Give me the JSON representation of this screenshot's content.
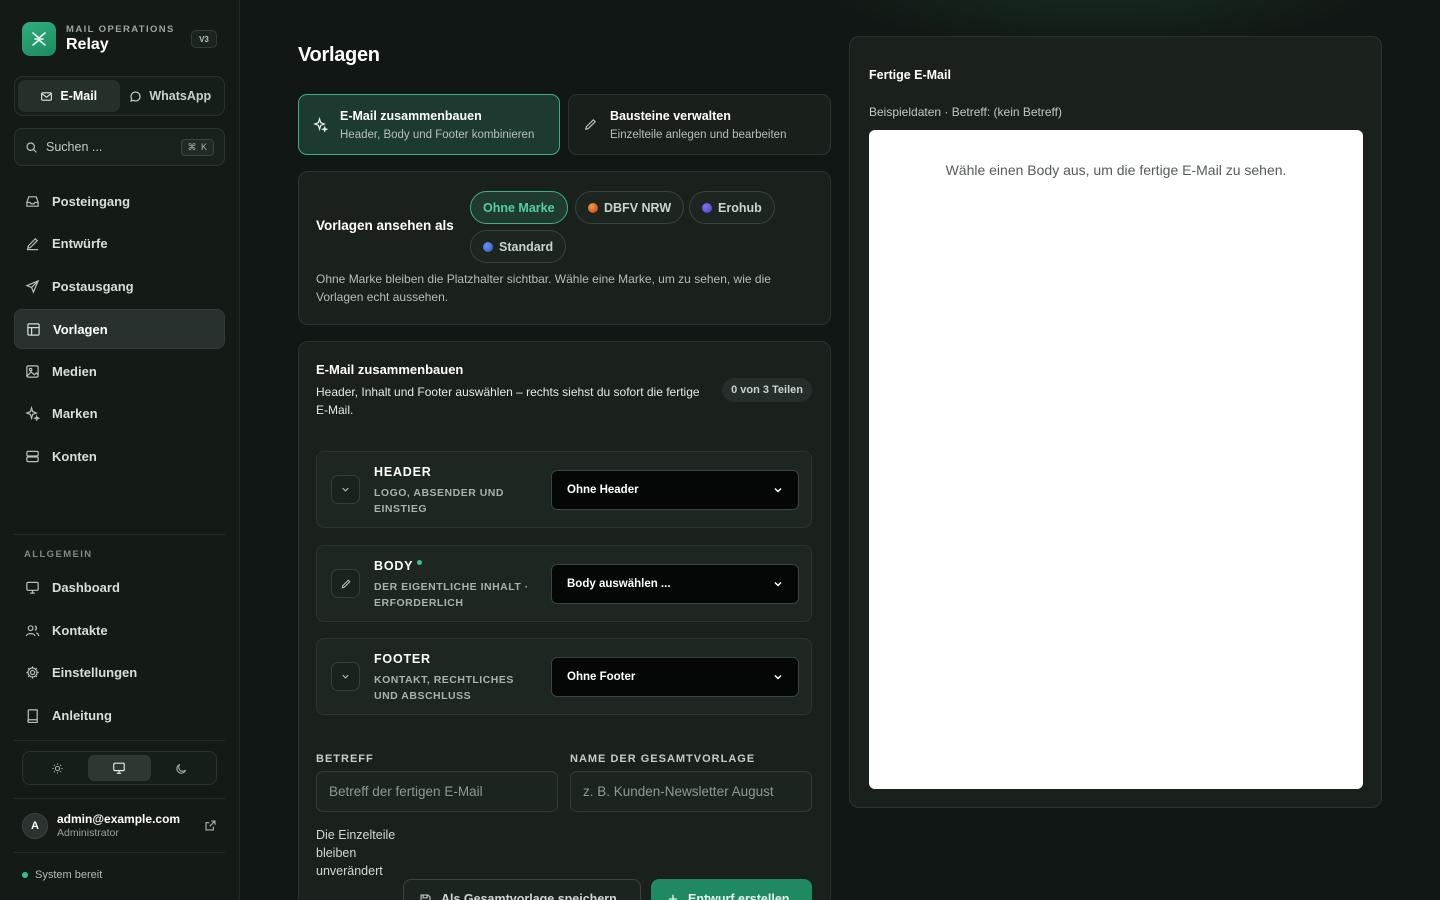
{
  "app": {
    "kicker": "MAIL OPERATIONS",
    "name": "Relay",
    "version": "V3"
  },
  "channels": [
    {
      "label": "E-Mail",
      "active": true
    },
    {
      "label": "WhatsApp",
      "active": false
    }
  ],
  "search": {
    "placeholder": "Suchen ...",
    "shortcut": "⌘ K"
  },
  "nav": [
    {
      "label": "Posteingang",
      "icon": "inbox-icon"
    },
    {
      "label": "Entwürfe",
      "icon": "pen-icon"
    },
    {
      "label": "Postausgang",
      "icon": "send-icon"
    },
    {
      "label": "Vorlagen",
      "icon": "layout-icon",
      "active": true
    },
    {
      "label": "Medien",
      "icon": "image-icon"
    },
    {
      "label": "Marken",
      "icon": "sparkles-icon"
    },
    {
      "label": "Konten",
      "icon": "server-icon"
    }
  ],
  "general": {
    "label": "ALLGEMEIN",
    "items": [
      {
        "label": "Dashboard",
        "icon": "monitor-icon"
      },
      {
        "label": "Kontakte",
        "icon": "users-icon"
      },
      {
        "label": "Einstellungen",
        "icon": "gear-icon"
      },
      {
        "label": "Anleitung",
        "icon": "book-icon"
      }
    ]
  },
  "theme": {
    "options": [
      "light",
      "system",
      "dark"
    ],
    "active": "system"
  },
  "user": {
    "initial": "A",
    "email": "admin@example.com",
    "role": "Administrator"
  },
  "status": {
    "text": "System bereit"
  },
  "page": {
    "title": "Vorlagen"
  },
  "modes": [
    {
      "title": "E-Mail zusammenbauen",
      "subtitle": "Header, Body und Footer kombinieren",
      "active": true
    },
    {
      "title": "Bausteine verwalten",
      "subtitle": "Einzelteile anlegen und bearbeiten",
      "active": false
    }
  ],
  "brand_view": {
    "label": "Vorlagen ansehen als",
    "options": [
      {
        "label": "Ohne Marke",
        "active": true
      },
      {
        "label": "DBFV NRW",
        "color": "#d8432f"
      },
      {
        "label": "Erohub",
        "color": "#5b4fd6"
      },
      {
        "label": "Standard",
        "color": "#3b6fe0"
      }
    ],
    "note": "Ohne Marke bleiben die Platzhalter sichtbar. Wähle eine Marke, um zu sehen, wie die Vorlagen echt aussehen."
  },
  "builder": {
    "title": "E-Mail zusammenbauen",
    "subtitle": "Header, Inhalt und Footer auswählen – rechts siehst du sofort die fertige E-Mail.",
    "count": "0 von 3 Teilen",
    "parts": [
      {
        "name": "HEADER",
        "desc": "LOGO, ABSENDER UND EINSTIEG",
        "select": "Ohne Header",
        "icon": "chevron-down-icon",
        "required": false
      },
      {
        "name": "BODY",
        "desc": "DER EIGENTLICHE INHALT · ERFORDERLICH",
        "select": "Body auswählen ...",
        "icon": "pen-icon",
        "required": true
      },
      {
        "name": "FOOTER",
        "desc": "KONTAKT, RECHTLICHES UND ABSCHLUSS",
        "select": "Ohne Footer",
        "icon": "chevron-down-icon",
        "required": false
      }
    ],
    "subject_label": "BETREFF",
    "subject_placeholder": "Betreff der fertigen E-Mail",
    "name_label": "NAME DER GESAMTVORLAGE",
    "name_placeholder": "z. B. Kunden-Newsletter August",
    "keep_note": "Die Einzelteile bleiben unverändert",
    "save_button": "Als Gesamtvorlage speichern",
    "create_button": "Entwurf erstellen"
  },
  "preview": {
    "title": "Fertige E-Mail",
    "meta": "Beispieldaten · Betreff: (kein Betreff)",
    "empty": "Wähle einen Body aus, um die fertige E-Mail zu sehen."
  }
}
